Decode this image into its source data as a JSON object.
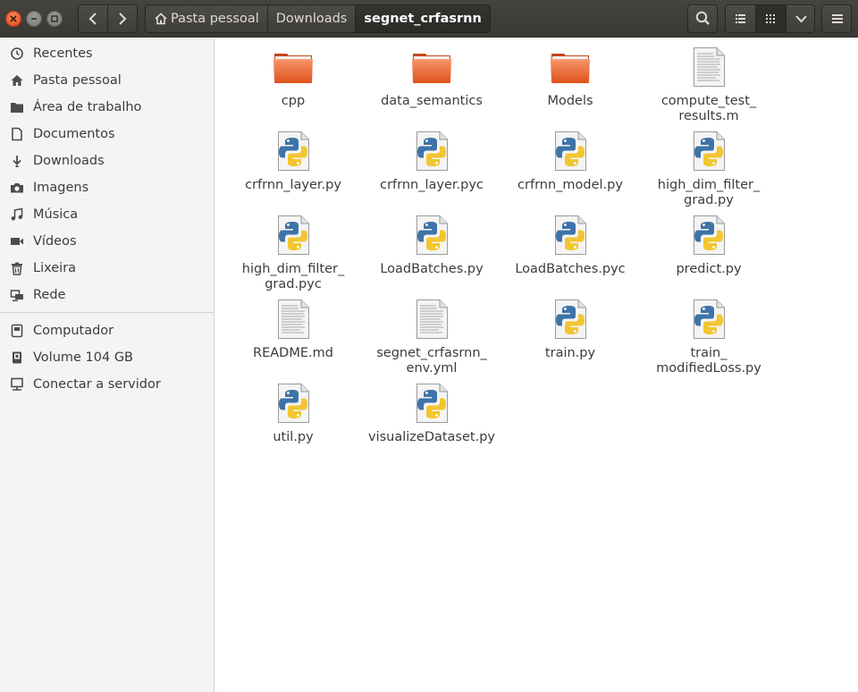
{
  "header": {
    "breadcrumbs": [
      "Pasta pessoal",
      "Downloads",
      "segnet_crfasrnn"
    ]
  },
  "sidebar": {
    "places": [
      {
        "label": "Recentes",
        "icon": "clock-icon"
      },
      {
        "label": "Pasta pessoal",
        "icon": "home-icon"
      },
      {
        "label": "Área de trabalho",
        "icon": "folder-icon"
      },
      {
        "label": "Documentos",
        "icon": "document-icon"
      },
      {
        "label": "Downloads",
        "icon": "download-icon"
      },
      {
        "label": "Imagens",
        "icon": "camera-icon"
      },
      {
        "label": "Música",
        "icon": "music-icon"
      },
      {
        "label": "Vídeos",
        "icon": "video-icon"
      },
      {
        "label": "Lixeira",
        "icon": "trash-icon"
      },
      {
        "label": "Rede",
        "icon": "network-icon"
      }
    ],
    "devices": [
      {
        "label": "Computador",
        "icon": "computer-icon"
      },
      {
        "label": "Volume 104 GB",
        "icon": "drive-icon"
      },
      {
        "label": "Conectar a servidor",
        "icon": "server-icon"
      }
    ]
  },
  "files": [
    {
      "name": "cpp",
      "type": "folder"
    },
    {
      "name": "data_semantics",
      "type": "folder"
    },
    {
      "name": "Models",
      "type": "folder"
    },
    {
      "name": "compute_test_\nresults.m",
      "type": "text"
    },
    {
      "name": "crfrnn_layer.py",
      "type": "python"
    },
    {
      "name": "crfrnn_layer.pyc",
      "type": "python"
    },
    {
      "name": "crfrnn_model.py",
      "type": "python"
    },
    {
      "name": "high_dim_filter_\ngrad.py",
      "type": "python"
    },
    {
      "name": "high_dim_filter_\ngrad.pyc",
      "type": "python"
    },
    {
      "name": "LoadBatches.py",
      "type": "python"
    },
    {
      "name": "LoadBatches.pyc",
      "type": "python"
    },
    {
      "name": "predict.py",
      "type": "python"
    },
    {
      "name": "README.md",
      "type": "text"
    },
    {
      "name": "segnet_crfasrnn_\nenv.yml",
      "type": "text"
    },
    {
      "name": "train.py",
      "type": "python"
    },
    {
      "name": "train_\nmodifiedLoss.py",
      "type": "python"
    },
    {
      "name": "util.py",
      "type": "python"
    },
    {
      "name": "visualizeDataset.py",
      "type": "python"
    }
  ],
  "colors": {
    "header_bg": "#3d3c38",
    "sidebar_bg": "#f5f4f2",
    "folder_orange": "#e8602c",
    "close_button": "#e8501e"
  }
}
